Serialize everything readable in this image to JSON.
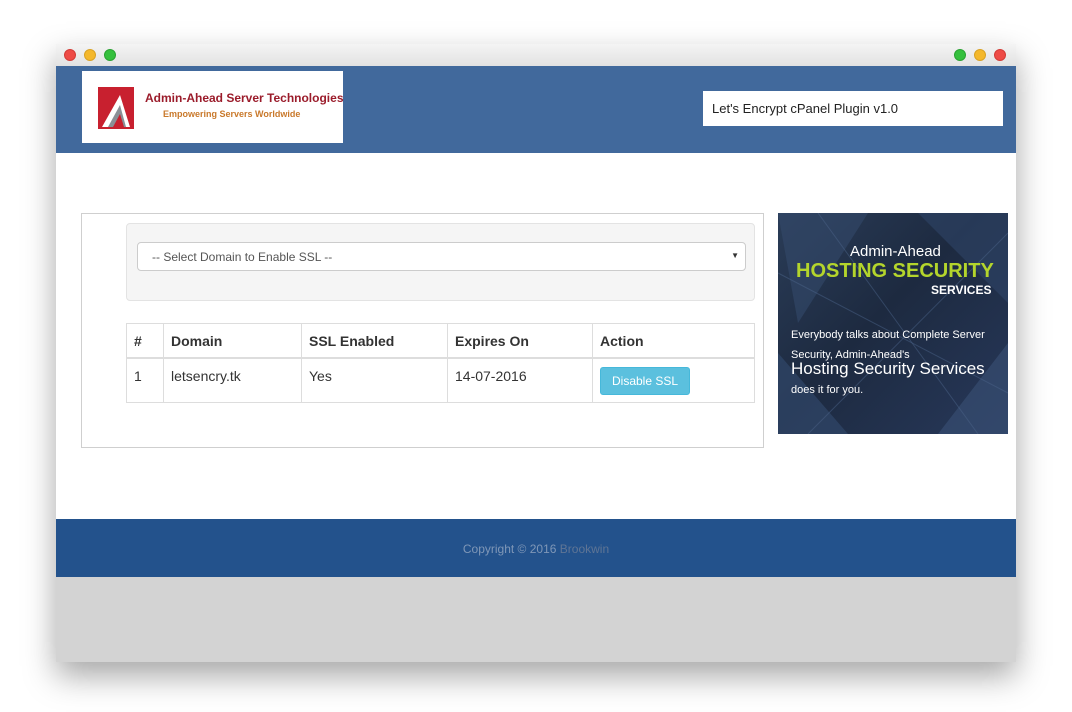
{
  "window": {
    "traffic_lights_left": [
      "close",
      "minimize",
      "maximize"
    ],
    "traffic_lights_right": [
      "maximize",
      "minimize",
      "close"
    ]
  },
  "header": {
    "logo": {
      "title": "Admin-Ahead Server Technologies",
      "subtitle": "Empowering Servers Worldwide"
    },
    "plugin_version": "Let's Encrypt cPanel Plugin v1.0"
  },
  "form": {
    "domain_select": {
      "selected": "-- Select Domain to Enable SSL --"
    }
  },
  "table": {
    "headers": [
      "#",
      "Domain",
      "SSL Enabled",
      "Expires On",
      "Action"
    ],
    "rows": [
      {
        "num": "1",
        "domain": "letsencry.tk",
        "ssl_enabled": "Yes",
        "expires_on": "14-07-2016",
        "action_label": "Disable SSL"
      }
    ]
  },
  "ad": {
    "line1": "Admin-Ahead",
    "line2": "HOSTING SECURITY",
    "line3": "SERVICES",
    "body": "Everybody talks about Complete Server Security, Admin-Ahead's",
    "highlight": "Hosting Security Services",
    "tail": "does it for you."
  },
  "footer": {
    "copyright": "Copyright © 2016",
    "brand": "Brookwin"
  },
  "colors": {
    "header_bg": "#41699c",
    "footer_bg": "#23528c",
    "button_info": "#5bc0de",
    "ad_accent": "#b4d52c"
  }
}
